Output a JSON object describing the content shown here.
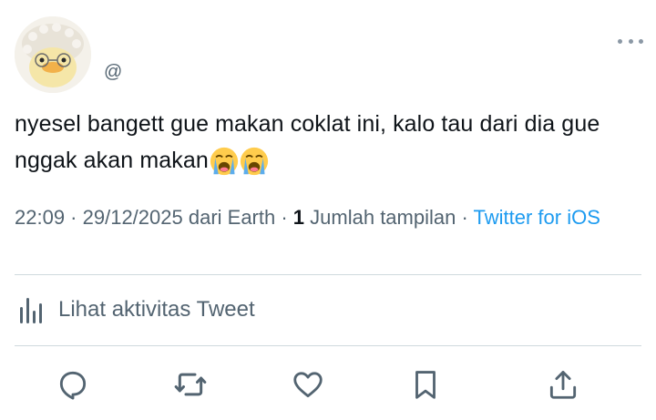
{
  "user": {
    "handle": "@"
  },
  "tweet": {
    "text": "nyesel bangett gue makan coklat ini, kalo tau dari dia gue nggak akan makan",
    "emojis": [
      "loudly-crying-face",
      "loudly-crying-face"
    ]
  },
  "meta": {
    "time": "22:09",
    "sep1": " · ",
    "date": "29/12/2025",
    "source_prefix": " dari Earth",
    "sep2": " · ",
    "views_count": "1",
    "views_label": " Jumlah tampilan",
    "sep3": " · ",
    "client": "Twitter for iOS"
  },
  "activity": {
    "label": "Lihat aktivitas Tweet"
  },
  "actions": {
    "icons": [
      "reply-icon",
      "retweet-icon",
      "like-icon",
      "bookmark-icon",
      "share-icon"
    ]
  },
  "colors": {
    "text": "#0f1419",
    "secondary": "#536471",
    "link": "#1d9bf0",
    "divider": "#cfd9de"
  }
}
